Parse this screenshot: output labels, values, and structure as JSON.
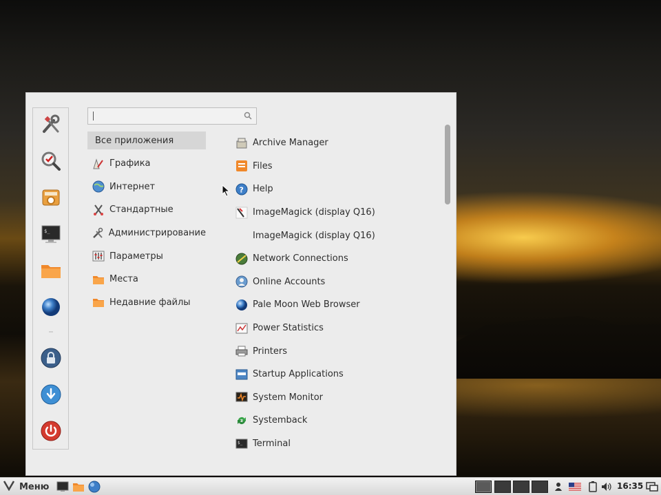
{
  "search": {
    "placeholder": ""
  },
  "categories": [
    {
      "label": "Все приложения",
      "icon": "all-apps",
      "active": true
    },
    {
      "label": "Графика",
      "icon": "graphics-icon"
    },
    {
      "label": "Интернет",
      "icon": "globe-icon"
    },
    {
      "label": "Стандартные",
      "icon": "accessories-icon"
    },
    {
      "label": "Администрирование",
      "icon": "tools-icon"
    },
    {
      "label": "Параметры",
      "icon": "settings-icon"
    },
    {
      "label": "Места",
      "icon": "folder-icon"
    },
    {
      "label": "Недавние файлы",
      "icon": "folder-icon"
    }
  ],
  "apps": [
    {
      "label": "Archive Manager",
      "icon": "archive-icon"
    },
    {
      "label": "Files",
      "icon": "files-icon"
    },
    {
      "label": "Help",
      "icon": "help-icon"
    },
    {
      "label": "ImageMagick (display Q16)",
      "icon": "imagemagick-icon"
    },
    {
      "label": "ImageMagick (display Q16)",
      "icon": "none"
    },
    {
      "label": "Network Connections",
      "icon": "network-icon"
    },
    {
      "label": "Online Accounts",
      "icon": "online-accounts-icon"
    },
    {
      "label": "Pale Moon Web Browser",
      "icon": "palemoon-icon"
    },
    {
      "label": "Power Statistics",
      "icon": "power-stats-icon"
    },
    {
      "label": "Printers",
      "icon": "printer-icon"
    },
    {
      "label": "Startup Applications",
      "icon": "startup-icon"
    },
    {
      "label": "System Monitor",
      "icon": "system-monitor-icon"
    },
    {
      "label": "Systemback",
      "icon": "systemback-icon"
    },
    {
      "label": "Terminal",
      "icon": "terminal-icon"
    }
  ],
  "taskbar": {
    "menu_label": "Меню",
    "clock": "16:35"
  },
  "colors": {
    "orange": "#f0882a",
    "blue": "#3e7fc8",
    "red": "#d43a2f",
    "selected_bg": "#d6d6d6"
  }
}
